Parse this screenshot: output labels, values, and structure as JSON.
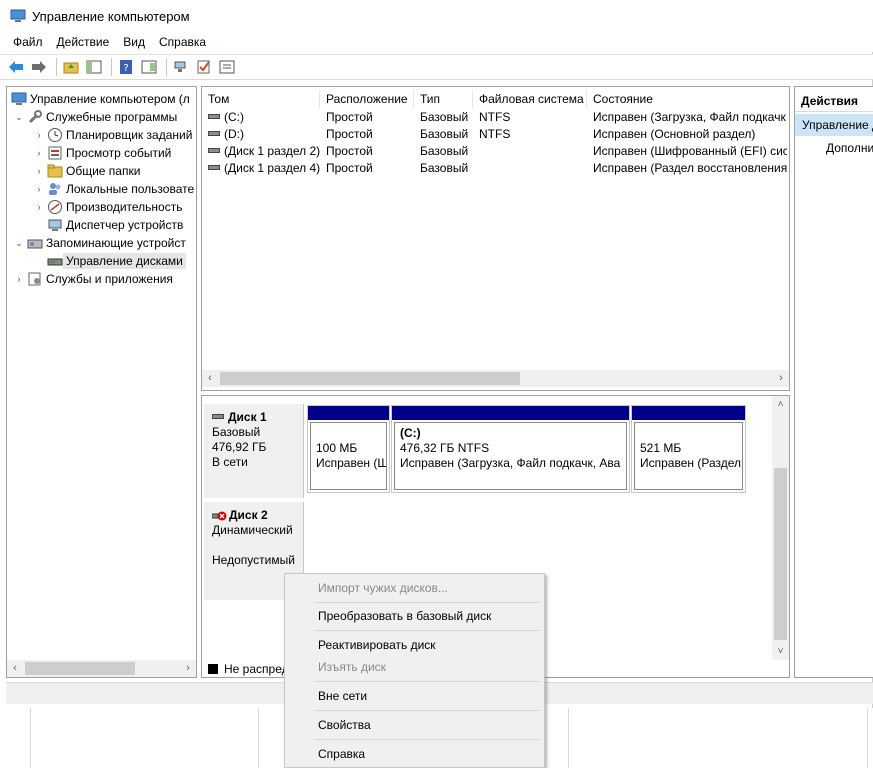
{
  "window": {
    "title": "Управление компьютером"
  },
  "menu": [
    "Файл",
    "Действие",
    "Вид",
    "Справка"
  ],
  "toolbar_icons": [
    "back-arrow-icon",
    "forward-arrow-icon",
    "up-folder-icon",
    "show-hide-tree-icon",
    "help-icon",
    "console-view-icon",
    "connect-icon",
    "check-icon",
    "properties-icon"
  ],
  "tree": {
    "root": "Управление компьютером (л",
    "items": [
      {
        "label": "Служебные программы",
        "icon": "tools-icon",
        "level": 1,
        "expanded": true
      },
      {
        "label": "Планировщик заданий",
        "icon": "clock-icon",
        "level": 2
      },
      {
        "label": "Просмотр событий",
        "icon": "event-viewer-icon",
        "level": 2
      },
      {
        "label": "Общие папки",
        "icon": "shared-folder-icon",
        "level": 2
      },
      {
        "label": "Локальные пользовате",
        "icon": "users-icon",
        "level": 2
      },
      {
        "label": "Производительность",
        "icon": "performance-icon",
        "level": 2
      },
      {
        "label": "Диспетчер устройств",
        "icon": "device-manager-icon",
        "level": 2
      },
      {
        "label": "Запоминающие устройст",
        "icon": "storage-icon",
        "level": 1,
        "expanded": true
      },
      {
        "label": "Управление дисками",
        "icon": "disk-management-icon",
        "level": 2,
        "selected": true
      },
      {
        "label": "Службы и приложения",
        "icon": "services-icon",
        "level": 1,
        "expanded": false
      }
    ]
  },
  "volumes": {
    "columns": [
      "Том",
      "Расположение",
      "Тип",
      "Файловая система",
      "Состояние"
    ],
    "rows": [
      [
        "(C:)",
        "Простой",
        "Базовый",
        "NTFS",
        "Исправен (Загрузка, Файл подкачк"
      ],
      [
        "(D:)",
        "Простой",
        "Базовый",
        "NTFS",
        "Исправен (Основной раздел)"
      ],
      [
        "(Диск 1 раздел 2)",
        "Простой",
        "Базовый",
        "",
        "Исправен (Шифрованный (EFI) сист"
      ],
      [
        "(Диск 1 раздел 4)",
        "Простой",
        "Базовый",
        "",
        "Исправен (Раздел восстановления)"
      ]
    ]
  },
  "disks": [
    {
      "name": "Диск 1",
      "type": "Базовый",
      "size": "476,92 ГБ",
      "status": "В сети",
      "partitions": [
        {
          "label": "",
          "size": "100 МБ",
          "status": "Исправен (Ш"
        },
        {
          "label": "(C:)",
          "size": "476,32 ГБ NTFS",
          "status": "Исправен (Загрузка, Файл подкачк, Ава"
        },
        {
          "label": "",
          "size": "521 МБ",
          "status": "Исправен (Раздел"
        }
      ]
    },
    {
      "name": "Диск 2",
      "type": "Динамический",
      "size": "",
      "status": "Недопустимый"
    }
  ],
  "legend": {
    "unallocated": "Не распред"
  },
  "actions": {
    "header": "Действия",
    "selected": "Управление д",
    "more": "Дополни"
  },
  "context_menu": [
    {
      "label": "Импорт чужих дисков...",
      "disabled": true
    },
    {
      "label": "Преобразовать в базовый диск",
      "disabled": false
    },
    {
      "label": "Реактивировать диск",
      "disabled": false
    },
    {
      "label": "Изъять диск",
      "disabled": true
    },
    {
      "label": "Вне сети",
      "disabled": false
    },
    {
      "label": "Свойства",
      "disabled": false
    },
    {
      "label": "Справка",
      "disabled": false
    }
  ],
  "colors": {
    "partition_bar": "#00008b",
    "selection": "#cce4f7",
    "error_red": "#d00000"
  }
}
